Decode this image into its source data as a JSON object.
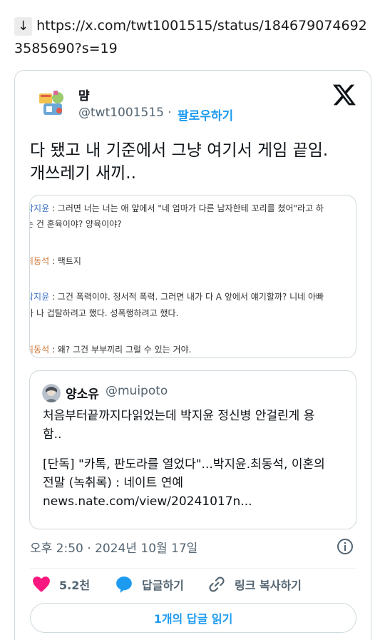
{
  "header": {
    "arrow": "↓",
    "url_part1": "https://x.com/twt1001515/status/18467907469235",
    "url_part2": "85690?s=19"
  },
  "tweet": {
    "author_name": "먐",
    "author_handle": "@twt1001515",
    "separator": "·",
    "follow_label": "팔로우하기",
    "text_line1": "다 됐고 내 기준에서 그냥 여기서 게임 끝임.",
    "text_line2": "개쓰레기 새끼..",
    "timestamp": "오후 2:50 · 2024년 10월 17일",
    "likes_count": "5.2천",
    "reply_label": "답글하기",
    "copy_link_label": "링크 복사하기",
    "read_replies_label": "1개의 답글 읽기"
  },
  "media_transcript": [
    {
      "speaker": "박지윤",
      "text": " : 그러면 너는 너는 애 앞에서 \"네 엄마가 다른 남자한테 꼬리를 쳤어\"라고 하",
      "color": "blue"
    },
    {
      "speaker": "",
      "text": "는 건 훈육이야? 양육이야?",
      "color": ""
    },
    {
      "speaker": "최동석",
      "text": " : 팩트지",
      "color": "orange"
    },
    {
      "speaker": "박지윤",
      "text": " : 그건 폭력이야. 정서적 폭력. 그러면 내가 다 A 앞에서 얘기할까? 니네 아빠",
      "color": "blue"
    },
    {
      "speaker": "",
      "text": "가 나 겁탈하려고 했다. 성폭행하려고 했다.",
      "color": ""
    },
    {
      "speaker": "최동석",
      "text": " : 왜? 그건 부부끼리 그럴 수 있는 거야.",
      "color": "orange"
    }
  ],
  "quote": {
    "name": "양소유",
    "handle": "@muipoto",
    "line1": "처음부터끝까지다읽었는데 박지윤 정신병 안걸린게 용",
    "line2": "함..",
    "line3": "[단독] \"카톡, 판도라를 열었다\"...박지윤.최동석, 이혼의",
    "line4": "전말 (녹취록) : 네이트 연예",
    "line5": "news.nate.com/view/20241017n..."
  },
  "colors": {
    "accent": "#1d9bf0",
    "like": "#f91880",
    "secondary_text": "#536471",
    "border": "#cfd9de"
  },
  "icons": [
    "x-logo-icon",
    "info-icon",
    "heart-icon",
    "reply-bubble-icon",
    "link-icon"
  ]
}
